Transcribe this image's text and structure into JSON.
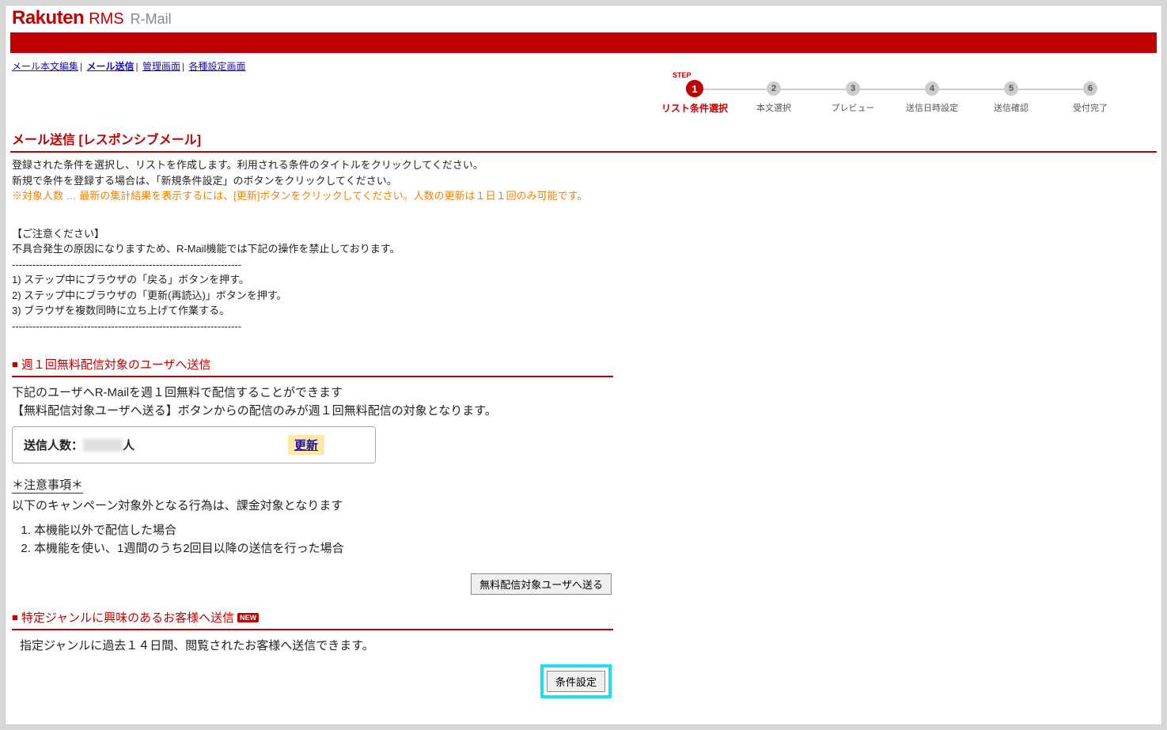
{
  "brand": {
    "main": "Rakuten",
    "rms": "RMS",
    "sub": "R-Mail"
  },
  "breadcrumb": {
    "items": [
      "メール本文編集",
      "メール送信",
      "管理画面",
      "各種設定画面"
    ],
    "active_index": 1
  },
  "steps": {
    "pre_label": "STEP",
    "items": [
      {
        "num": "1",
        "label": "リスト条件選択",
        "active": true
      },
      {
        "num": "2",
        "label": "本文選択"
      },
      {
        "num": "3",
        "label": "プレビュー"
      },
      {
        "num": "4",
        "label": "送信日時設定"
      },
      {
        "num": "5",
        "label": "送信確認"
      },
      {
        "num": "6",
        "label": "受付完了"
      }
    ]
  },
  "page_title": "メール送信 [レスポンシブメール]",
  "intro": {
    "line1": "登録された条件を選択し、リストを作成します。利用される条件のタイトルをクリックしてください。",
    "line2": "新規で条件を登録する場合は、「新規条件設定」のボタンをクリックしてください。",
    "note": "※対象人数 … 最新の集計結果を表示するには、[更新]ボタンをクリックしてください。人数の更新は１日１回のみ可能です。"
  },
  "caution": {
    "head": "【ご注意ください】",
    "lead": "不具合発生の原因になりますため、R-Mail機能では下記の操作を禁止しております。",
    "dash": "-------------------------------------------------------------------",
    "r1": "1) ステップ中にブラウザの「戻る」ボタンを押す。",
    "r2": "2) ステップ中にブラウザの「更新(再読込)」ボタンを押す。",
    "r3": "3) ブラウザを複数同時に立ち上げて作業する。"
  },
  "weekly": {
    "title": "週１回無料配信対象のユーザへ送信",
    "p1": "下記のユーザへR-Mailを週１回無料で配信することができます",
    "p2": "【無料配信対象ユーザへ送る】ボタンからの配信のみが週１回無料配信の対象となります。",
    "send_label": "送信人数：",
    "send_unit": "人",
    "update": "更新",
    "caution_head": "＊注意事項＊",
    "caution_lead": "以下のキャンペーン対象外となる行為は、課金対象となります",
    "li1": "本機能以外で配信した場合",
    "li2": "本機能を使い、1週間のうち2回目以降の送信を行った場合",
    "button": "無料配信対象ユーザへ送る"
  },
  "genre": {
    "title": "特定ジャンルに興味のあるお客様へ送信",
    "new": "NEW",
    "p1": "指定ジャンルに過去１４日間、閲覧されたお客様へ送信できます。",
    "button": "条件設定"
  }
}
